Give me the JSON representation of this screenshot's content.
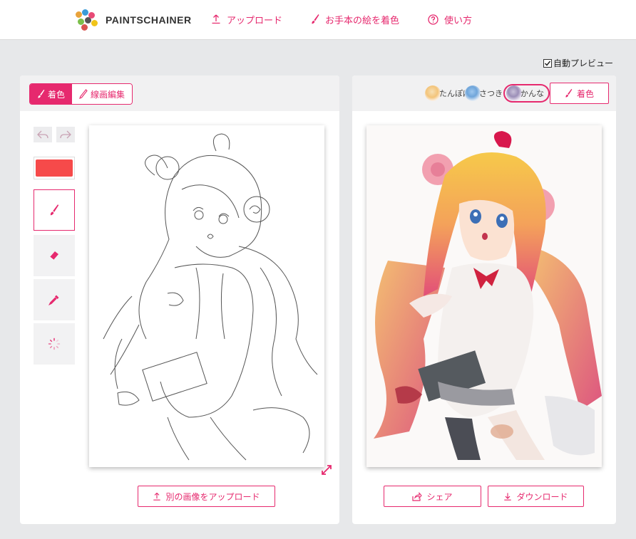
{
  "header": {
    "logo_text": "PAINTSCHAINER",
    "nav": [
      {
        "label": "アップロード",
        "icon": "upload-icon"
      },
      {
        "label": "お手本の絵を着色",
        "icon": "brush-icon"
      },
      {
        "label": "使い方",
        "icon": "help-circle-icon"
      }
    ]
  },
  "auto_preview": {
    "label": "自動プレビュー",
    "checked": true
  },
  "left_panel": {
    "mode_tabs": [
      {
        "label": "着色",
        "icon": "brush-icon",
        "active": true
      },
      {
        "label": "線画編集",
        "icon": "pencil-icon",
        "active": false
      }
    ],
    "tools": [
      "brush-icon",
      "eraser-icon",
      "eyedropper-icon",
      "spinner-icon"
    ],
    "selected_color": "#f64a4a",
    "upload_button": "別の画像をアップロード"
  },
  "right_panel": {
    "styles": [
      {
        "label": "たんぽぽ",
        "selected": false
      },
      {
        "label": "さつき",
        "selected": false
      },
      {
        "label": "かんな",
        "selected": true
      }
    ],
    "colorize_button": "着色",
    "share_button": "シェア",
    "download_button": "ダウンロード"
  },
  "colors": {
    "accent": "#e6296e",
    "background": "#e7e8ea"
  }
}
